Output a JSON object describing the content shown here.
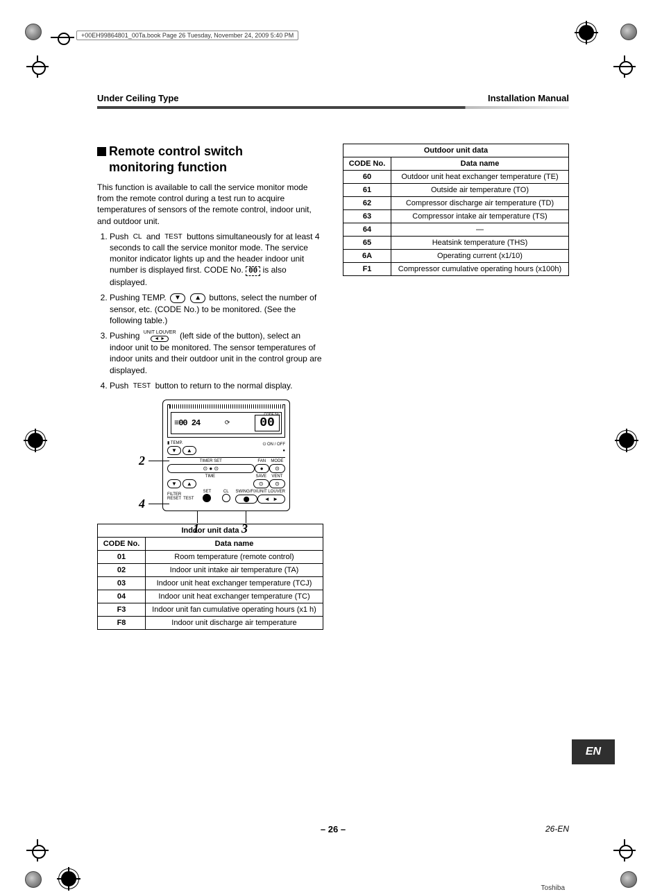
{
  "filetag": "+00EH99864801_00Ta.book  Page 26  Tuesday, November 24, 2009  5:40 PM",
  "header": {
    "left": "Under Ceiling Type",
    "right": "Installation Manual"
  },
  "section": {
    "title_line1": "Remote control switch",
    "title_line2": "monitoring function",
    "intro": "This function is available to call the service monitor mode from the remote control during a test run to acquire temperatures of sensors of the remote control, indoor unit, and outdoor unit.",
    "step1a": "Push ",
    "step1_icon1": "CL",
    "step1_mid": " and ",
    "step1_icon2": "TEST",
    "step1b": " buttons simultaneously for at least 4 seconds to call the service monitor mode. The service monitor indicator lights up and the header indoor unit number is displayed first. CODE No. ",
    "step1_code": "00",
    "step1c": " is also displayed.",
    "step2a": "Pushing TEMP. ",
    "step2_dn": "▼",
    "step2_up": "▲",
    "step2b": " buttons, select the number of sensor, etc. (CODE No.) to be monitored. (See the following table.)",
    "step3a": "Pushing ",
    "step3_unit_top": "UNIT  LOUVER",
    "step3_unit_btn": "◄   ►",
    "step3b": " (left side of the button), select an indoor unit to be monitored. The sensor temperatures of indoor units and their outdoor unit in the control group are displayed.",
    "step4a": "Push ",
    "step4_icon": "TEST",
    "step4b": " button to return to the normal display."
  },
  "remote": {
    "lcd_left": "≡00 24",
    "lcd_mid": "⟳",
    "lcd_digits": "00",
    "lcd_codeno": "CODE No.",
    "temp_label": "TEMP.",
    "onoff_label": "ON / OFF",
    "row_timer": "TIMER SET",
    "row_fan": "FAN",
    "row_mode": "MODE",
    "row_time": "TIME",
    "row_save": "SAVE",
    "row_vent": "VENT",
    "row_filter": "FILTER\nRESET  TEST",
    "row_set": "SET",
    "row_cl": "CL",
    "row_swing": "SWING/FIX",
    "row_unitlouver": "UNIT  LOUVER",
    "callout_1": "1",
    "callout_2": "2",
    "callout_3": "3",
    "callout_4": "4"
  },
  "indoor_table": {
    "title": "Indoor unit data",
    "h_code": "CODE No.",
    "h_name": "Data name",
    "rows": [
      {
        "code": "01",
        "name": "Room temperature (remote control)"
      },
      {
        "code": "02",
        "name": "Indoor unit intake air temperature (TA)"
      },
      {
        "code": "03",
        "name": "Indoor unit heat exchanger temperature (TCJ)"
      },
      {
        "code": "04",
        "name": "Indoor unit heat exchanger temperature (TC)"
      },
      {
        "code": "F3",
        "name": "Indoor unit fan cumulative operating hours (x1 h)"
      },
      {
        "code": "F8",
        "name": "Indoor unit discharge air temperature"
      }
    ]
  },
  "outdoor_table": {
    "title": "Outdoor unit data",
    "h_code": "CODE No.",
    "h_name": "Data name",
    "rows": [
      {
        "code": "60",
        "name": "Outdoor unit heat exchanger temperature (TE)"
      },
      {
        "code": "61",
        "name": "Outside air temperature (TO)"
      },
      {
        "code": "62",
        "name": "Compressor discharge air temperature (TD)"
      },
      {
        "code": "63",
        "name": "Compressor intake air temperature (TS)"
      },
      {
        "code": "64",
        "name": "—"
      },
      {
        "code": "65",
        "name": "Heatsink temperature (THS)"
      },
      {
        "code": "6A",
        "name": "Operating current (x1/10)"
      },
      {
        "code": "F1",
        "name": "Compressor cumulative operating hours (x100h)"
      }
    ]
  },
  "lang": "EN",
  "footer": {
    "center": "– 26 –",
    "right": "26-EN"
  },
  "brand": "Toshiba"
}
